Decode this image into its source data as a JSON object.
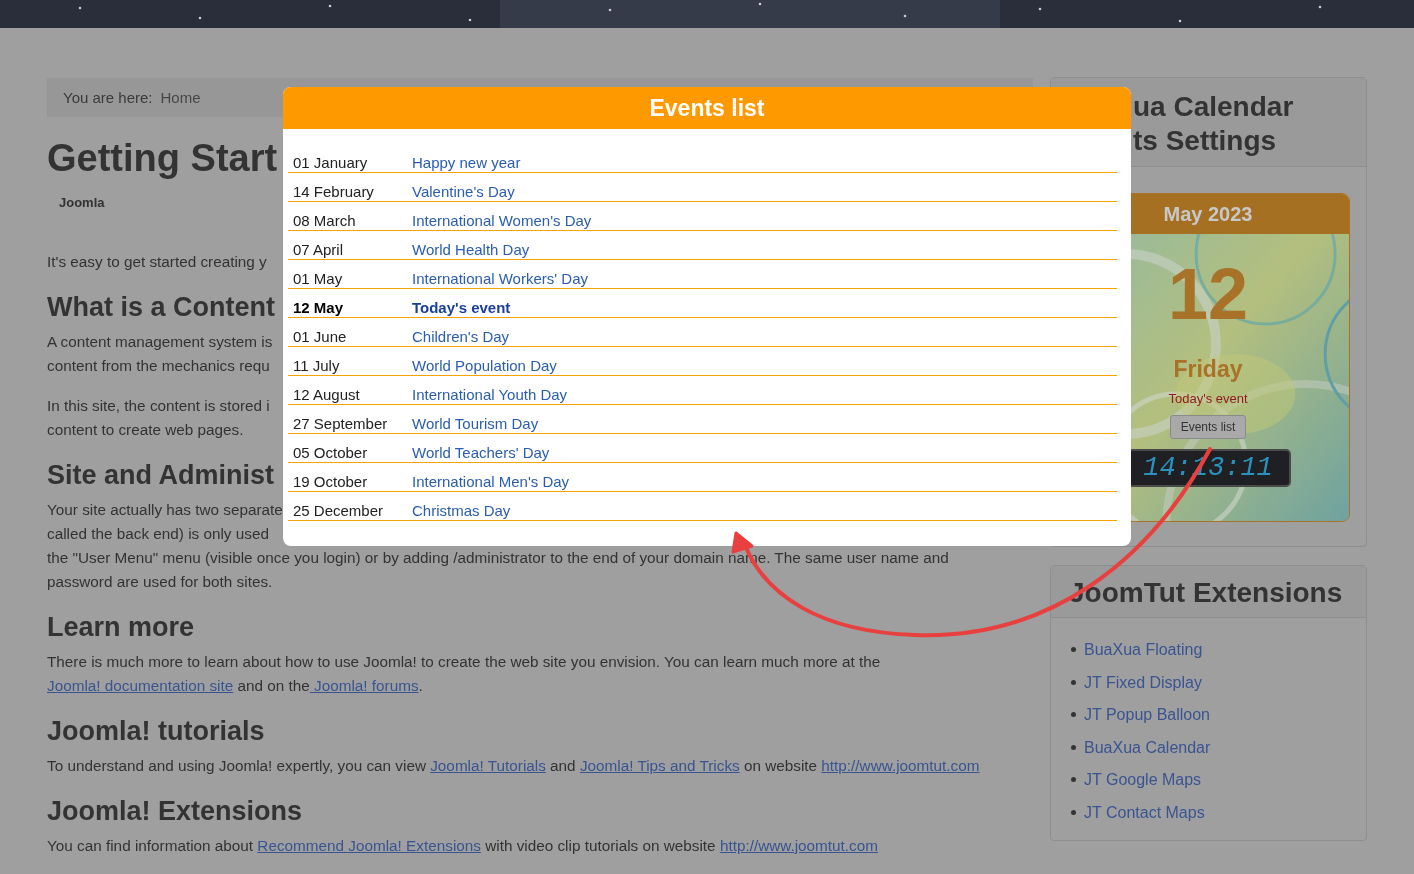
{
  "breadcrumb": {
    "label": "You are here:",
    "current": "Home"
  },
  "article": {
    "title": "Getting Start",
    "author": "Joomla",
    "blocks": [
      {
        "kind": "cut_paragraph",
        "lines": [
          "It's easy to get started creating y"
        ]
      },
      {
        "kind": "heading",
        "text": "What is a Content"
      },
      {
        "kind": "cut_paragraph",
        "lines": [
          "A content management system is",
          "content from the mechanics requ"
        ]
      },
      {
        "kind": "cut_paragraph",
        "lines": [
          "In this site, the content is stored i",
          "content to create web pages."
        ]
      },
      {
        "kind": "heading",
        "text": "Site and Administ"
      },
      {
        "kind": "cut_paragraph",
        "lines": [
          "Your site actually has two separate",
          "called the back end) is only used",
          "the \"User Menu\" menu (visible once you login) or by adding /administrator to the end of your domain name. The same user name and",
          "password are used for both sites."
        ]
      },
      {
        "kind": "heading",
        "text": "Learn more"
      },
      {
        "kind": "paragraph",
        "segments": [
          {
            "text": "There is much more to learn about how to use Joomla! to create the web site you envision. You can learn much more at the ",
            "link": false
          },
          {
            "text": "Joomla! documentation site",
            "link": true
          },
          {
            "text": " and on the",
            "link": false
          },
          {
            "text": " Joomla! forums",
            "link": true
          },
          {
            "text": ".",
            "link": false
          }
        ]
      },
      {
        "kind": "heading",
        "text": "Joomla! tutorials"
      },
      {
        "kind": "paragraph",
        "segments": [
          {
            "text": "To understand and using Joomla! expertly, you can view ",
            "link": false
          },
          {
            "text": "Joomla! Tutorials",
            "link": true
          },
          {
            "text": " and ",
            "link": false
          },
          {
            "text": "Joomla! Tips and Tricks",
            "link": true
          },
          {
            "text": " on website ",
            "link": false
          },
          {
            "text": "http://www.joomtut.com",
            "link": true
          }
        ]
      },
      {
        "kind": "heading",
        "text": "Joomla! Extensions"
      },
      {
        "kind": "paragraph",
        "segments": [
          {
            "text": "You can find information about ",
            "link": false
          },
          {
            "text": "Recommend Joomla! Extensions",
            "link": true
          },
          {
            "text": " with video clip tutorials on website ",
            "link": false
          },
          {
            "text": "http://www.joomtut.com",
            "link": true
          }
        ]
      }
    ]
  },
  "sidebar": {
    "modules": [
      {
        "kind": "calendar",
        "title_lines": [
          "ua Calendar",
          "ts Settings"
        ],
        "calendar": {
          "month": "May 2023",
          "day": "12",
          "weekday": "Friday",
          "event_label": "Today's event",
          "button": "Events list",
          "clock": "14:13:11"
        }
      },
      {
        "kind": "links",
        "title": "JoomTut Extensions",
        "links": [
          "BuaXua Floating",
          "JT Fixed Display",
          "JT Popup Balloon",
          "BuaXua Calendar",
          "JT Google Maps",
          "JT Contact Maps"
        ]
      }
    ]
  },
  "events_popup": {
    "title": "Events list",
    "events": [
      {
        "date": "01 January",
        "name": "Happy new year",
        "today": false
      },
      {
        "date": "14 February",
        "name": "Valentine's Day",
        "today": false
      },
      {
        "date": "08 March",
        "name": "International Women's Day",
        "today": false
      },
      {
        "date": "07 April",
        "name": "World Health Day",
        "today": false
      },
      {
        "date": "01 May",
        "name": "International Workers' Day",
        "today": false
      },
      {
        "date": "12 May",
        "name": "Today's event",
        "today": true
      },
      {
        "date": "01 June",
        "name": "Children's Day",
        "today": false
      },
      {
        "date": "11 July",
        "name": "World Population Day",
        "today": false
      },
      {
        "date": "12 August",
        "name": "International Youth Day",
        "today": false
      },
      {
        "date": "27 September",
        "name": "World Tourism Day",
        "today": false
      },
      {
        "date": "05 October",
        "name": "World Teachers' Day",
        "today": false
      },
      {
        "date": "19 October",
        "name": "International Men's Day",
        "today": false
      },
      {
        "date": "25 December",
        "name": "Christmas Day",
        "today": false
      }
    ]
  }
}
